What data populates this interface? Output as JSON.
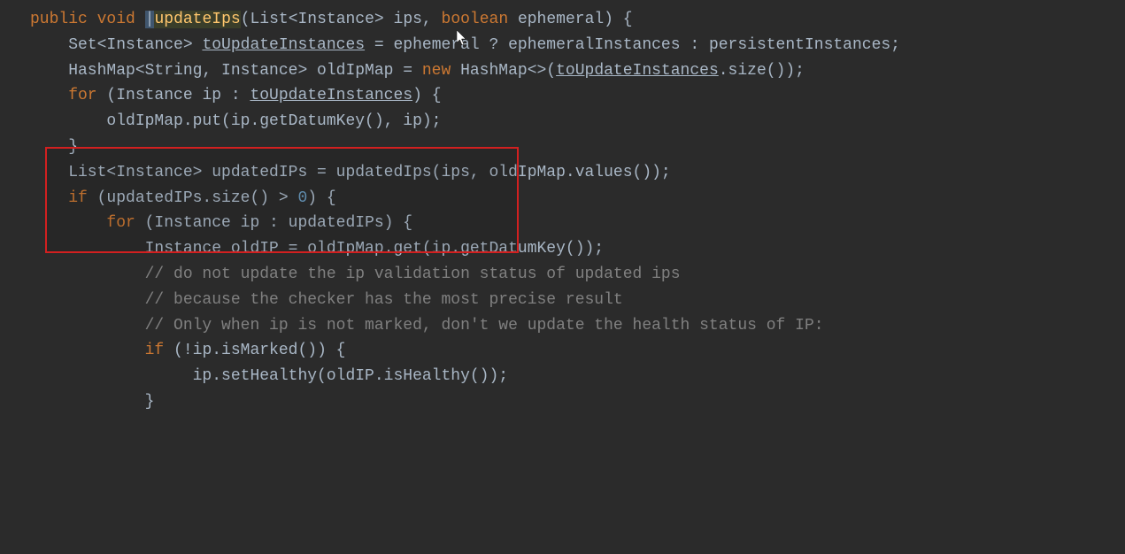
{
  "code": {
    "l1_public": "public",
    "l1_void": "void",
    "l1_method": "updateIps",
    "l1_p1": "(List<Instance> ips, ",
    "l1_boolean": "boolean",
    "l1_p2": " ephemeral) {",
    "l2": "",
    "l3_a": "    Set<Instance> ",
    "l3_toUpdate": "toUpdateInstances",
    "l3_b": " = ephemeral ? ephemeralInstances : persistentInstances;",
    "l4": "",
    "l5_a": "    HashMap<String, Instance> oldIpMap = ",
    "l5_new": "new",
    "l5_b": " HashMap<>(",
    "l5_toUpdate": "toUpdateInstances",
    "l5_c": ".size());",
    "l6": "",
    "l7_for": "    for",
    "l7_a": " (Instance ip : ",
    "l7_toUpdate": "toUpdateInstances",
    "l7_b": ") {",
    "l8": "        oldIpMap.put(ip.getDatumKey(), ip);",
    "l9": "    }",
    "l10": "",
    "l11": "    List<Instance> updatedIPs = updatedIps(ips, oldIpMap.values());",
    "l12_if": "    if",
    "l12_a": " (updatedIPs.size() > ",
    "l12_zero": "0",
    "l12_b": ") {",
    "l13_for": "        for",
    "l13_a": " (Instance ip : updatedIPs) {",
    "l14": "            Instance oldIP = oldIpMap.get(ip.getDatumKey());",
    "l15": "",
    "l16": "            // do not update the ip validation status of updated ips",
    "l17": "            // because the checker has the most precise result",
    "l18": "            // Only when ip is not marked, don't we update the health status of IP:",
    "l19_if": "            if",
    "l19_a": " (!ip.isMarked()) {",
    "l20": "                 ip.setHealthy(oldIP.isHealthy());",
    "l21": "            }"
  }
}
